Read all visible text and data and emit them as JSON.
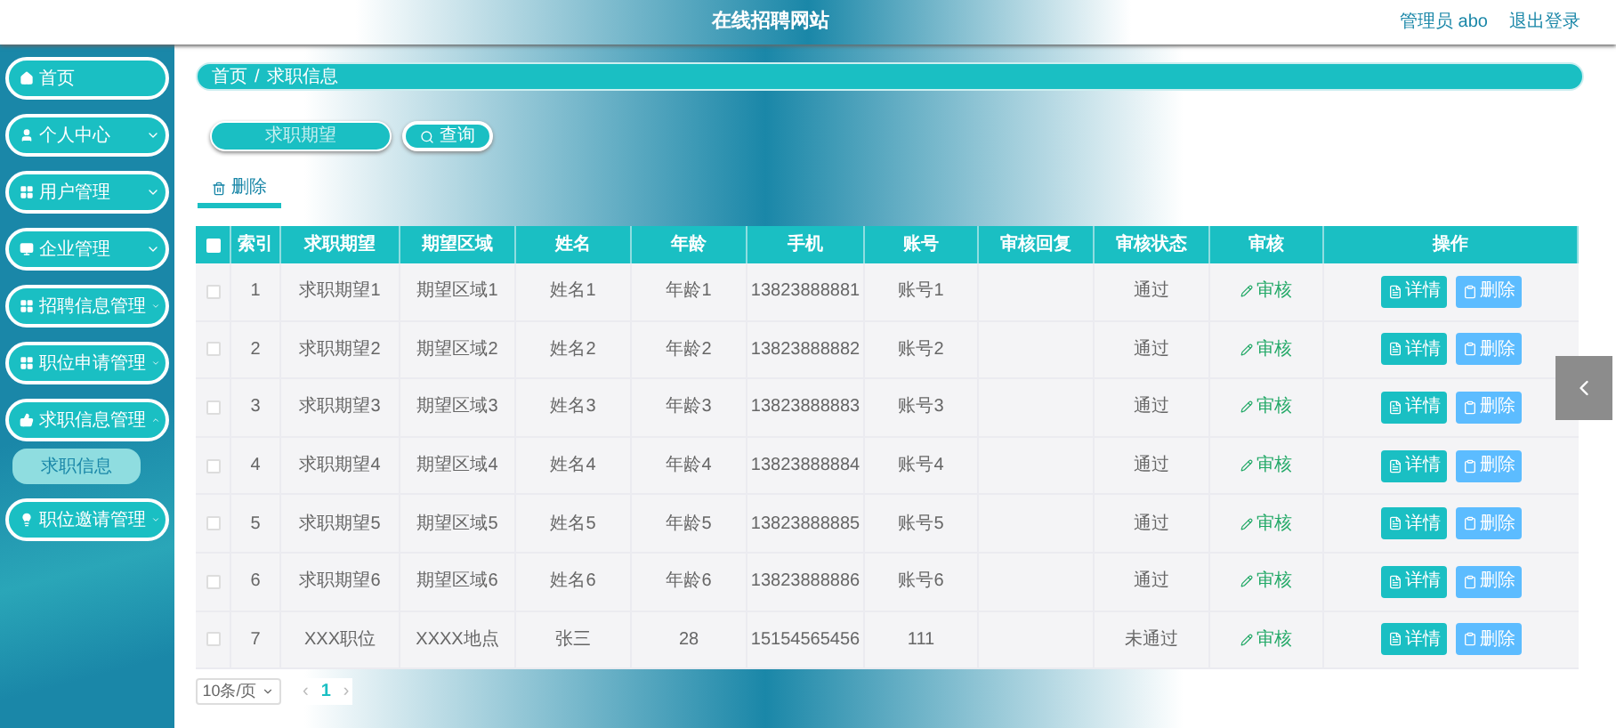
{
  "header": {
    "title": "在线招聘网站",
    "user": "管理员 abo",
    "logout": "退出登录"
  },
  "sidebar": {
    "items": [
      {
        "label": "首页"
      },
      {
        "label": "个人中心",
        "expanded": false
      },
      {
        "label": "用户管理",
        "expanded": false
      },
      {
        "label": "企业管理",
        "expanded": false
      },
      {
        "label": "招聘信息管理",
        "expanded": false
      },
      {
        "label": "职位申请管理",
        "expanded": false
      },
      {
        "label": "求职信息管理",
        "expanded": true,
        "children": [
          {
            "label": "求职信息",
            "selected": true
          }
        ]
      },
      {
        "label": "职位邀请管理",
        "expanded": false
      }
    ]
  },
  "breadcrumb": [
    "首页",
    "/",
    "求职信息"
  ],
  "search": {
    "placeholder": "求职期望",
    "button": "查询"
  },
  "toolbar": {
    "delete": "删除"
  },
  "table": {
    "header_checked": false,
    "columns": [
      "索引",
      "求职期望",
      "期望区域",
      "姓名",
      "年龄",
      "手机",
      "账号",
      "审核回复",
      "审核状态",
      "审核",
      "操作"
    ],
    "rows": [
      {
        "checked": false,
        "cells": [
          "1",
          "求职期望1",
          "期望区域1",
          "姓名1",
          "年龄1",
          "13823888881",
          "账号1",
          "",
          "通过"
        ],
        "review": "审核",
        "detail": "详情",
        "delete": "删除"
      },
      {
        "checked": false,
        "cells": [
          "2",
          "求职期望2",
          "期望区域2",
          "姓名2",
          "年龄2",
          "13823888882",
          "账号2",
          "",
          "通过"
        ],
        "review": "审核",
        "detail": "详情",
        "delete": "删除"
      },
      {
        "checked": false,
        "cells": [
          "3",
          "求职期望3",
          "期望区域3",
          "姓名3",
          "年龄3",
          "13823888883",
          "账号3",
          "",
          "通过"
        ],
        "review": "审核",
        "detail": "详情",
        "delete": "删除"
      },
      {
        "checked": false,
        "cells": [
          "4",
          "求职期望4",
          "期望区域4",
          "姓名4",
          "年龄4",
          "13823888884",
          "账号4",
          "",
          "通过"
        ],
        "review": "审核",
        "detail": "详情",
        "delete": "删除"
      },
      {
        "checked": false,
        "cells": [
          "5",
          "求职期望5",
          "期望区域5",
          "姓名5",
          "年龄5",
          "13823888885",
          "账号5",
          "",
          "通过"
        ],
        "review": "审核",
        "detail": "详情",
        "delete": "删除"
      },
      {
        "checked": false,
        "cells": [
          "6",
          "求职期望6",
          "期望区域6",
          "姓名6",
          "年龄6",
          "13823888886",
          "账号6",
          "",
          "通过"
        ],
        "review": "审核",
        "detail": "详情",
        "delete": "删除"
      },
      {
        "checked": false,
        "cells": [
          "7",
          "XXX职位",
          "XXXX地点",
          "张三",
          "28",
          "15154565456",
          "111",
          "",
          "未通过"
        ],
        "review": "审核",
        "detail": "详情",
        "delete": "删除"
      }
    ]
  },
  "pagination": {
    "page_size": "10条/页",
    "prev": "‹",
    "next": "›",
    "pages": [
      {
        "label": "1",
        "selected": true
      }
    ]
  }
}
